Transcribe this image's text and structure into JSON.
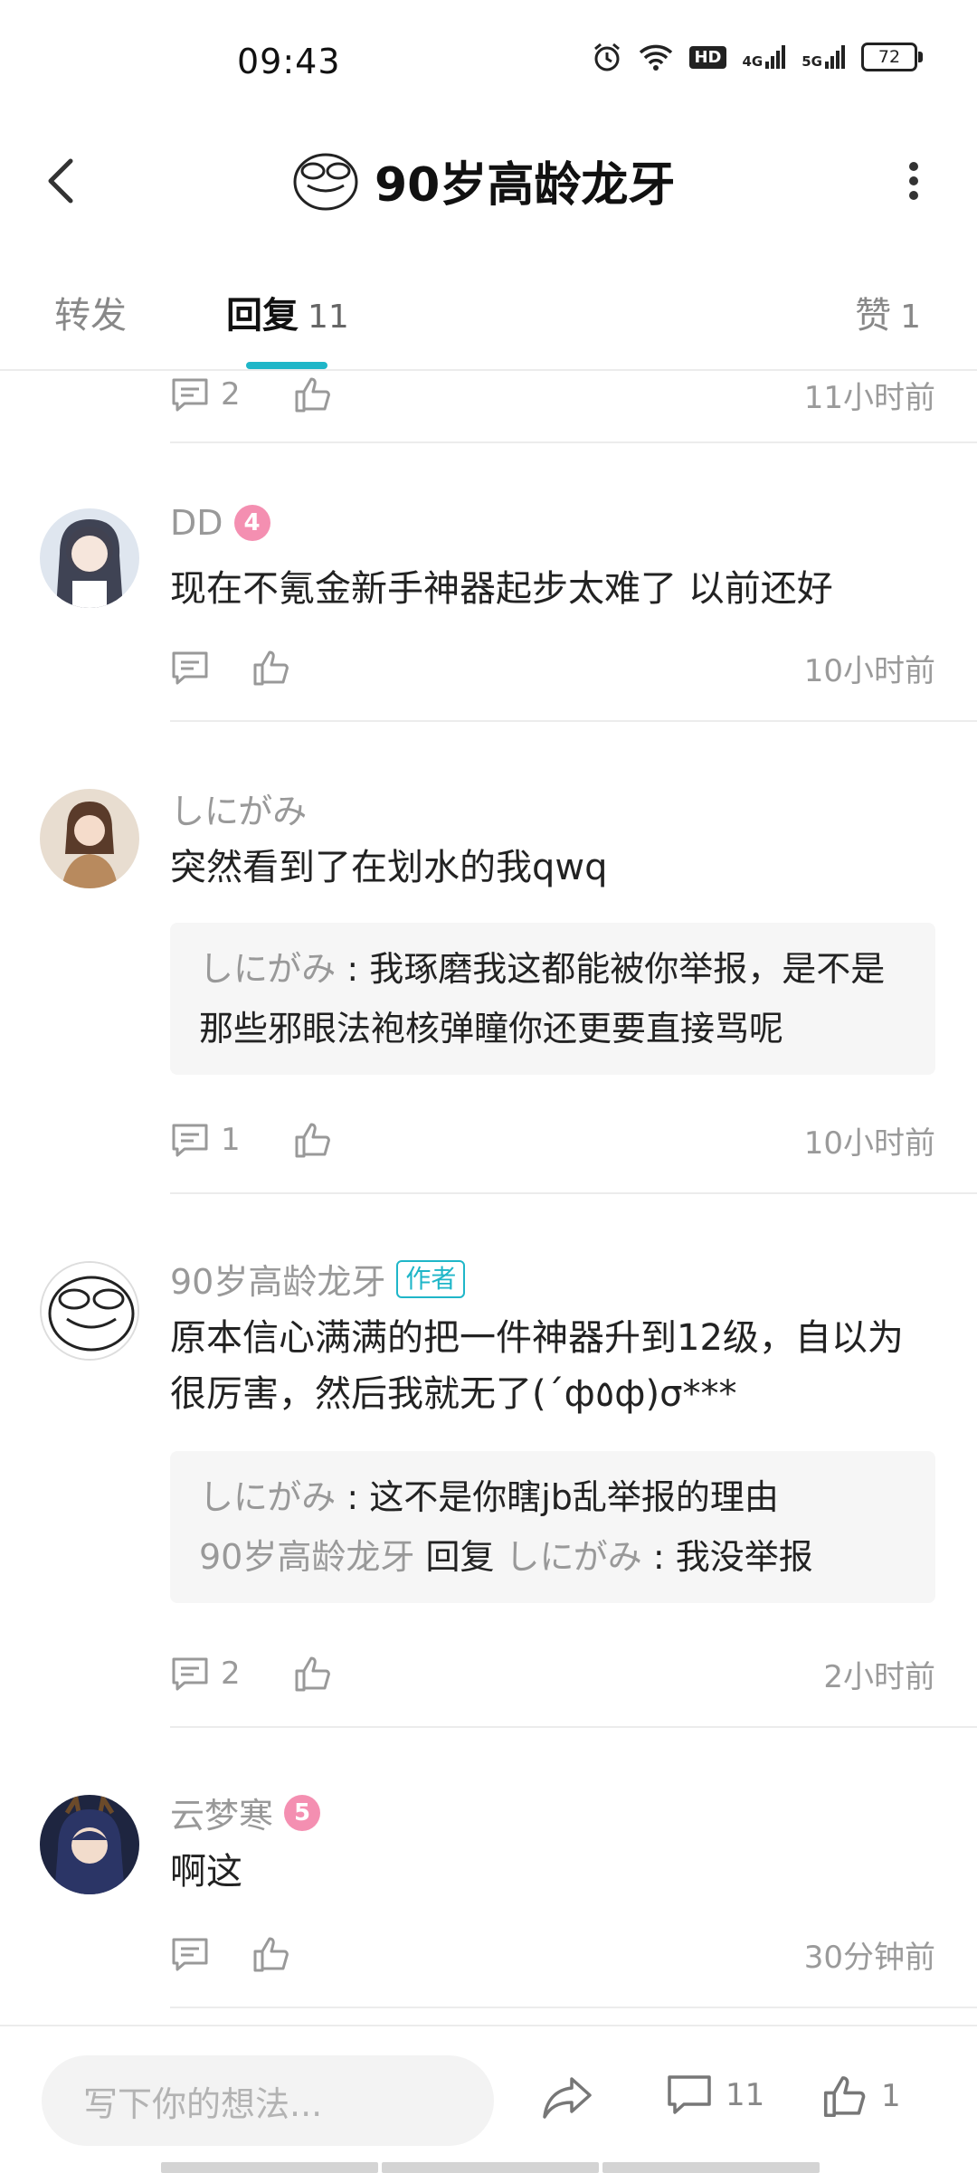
{
  "status_bar": {
    "time": "09:43",
    "battery": "72",
    "hd": "HD",
    "net1": "4G",
    "net2": "5G"
  },
  "header": {
    "title": "90岁高龄龙牙"
  },
  "tabs": [
    {
      "label": "转发",
      "count": ""
    },
    {
      "label": "回复",
      "count": "11"
    },
    {
      "label": "赞",
      "count": "1"
    }
  ],
  "top_partial": {
    "comment_count": "2",
    "time": "11小时前"
  },
  "comments": [
    {
      "user": "DD",
      "level": "4",
      "text": "现在不氪金新手神器起步太难了 以前还好",
      "comment_count": "",
      "time": "10小时前"
    },
    {
      "user": "しにがみ",
      "text": "突然看到了在划水的我qwq",
      "sub_replies": [
        {
          "who": "しにがみ",
          "sep": " : ",
          "text": "我琢磨我这都能被你举报，是不是那些邪眼法袍核弹瞳你还更要直接骂呢"
        }
      ],
      "comment_count": "1",
      "time": "10小时前"
    },
    {
      "user": "90岁高龄龙牙",
      "tag": "作者",
      "text": "原本信心满满的把一件神器升到12级，自以为很厉害，然后我就无了(´ф٥ф)σ***",
      "sub_replies": [
        {
          "who": "しにがみ",
          "sep": " : ",
          "text": "这不是你瞎jb乱举报的理由"
        },
        {
          "who": "90岁高龄龙牙",
          "mid": " 回复 ",
          "who2": "しにがみ",
          "sep": " : ",
          "text": "我没举报"
        }
      ],
      "comment_count": "2",
      "time": "2小时前"
    },
    {
      "user": "云梦寒",
      "level": "5",
      "text": "啊这",
      "comment_count": "",
      "time": "30分钟前"
    }
  ],
  "bottom_bar": {
    "placeholder": "写下你的想法...",
    "comment_count": "11",
    "like_count": "1"
  },
  "colors": {
    "accent": "#1fb6c8",
    "level_badge": "#f48fb1",
    "muted": "#999999"
  }
}
